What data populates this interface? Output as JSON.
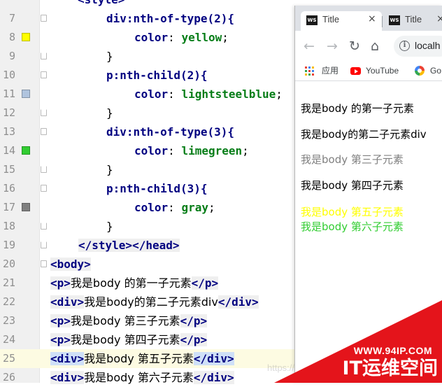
{
  "editor": {
    "lines": [
      {
        "num": "7",
        "swatch": null,
        "fold": "start",
        "indent": 2,
        "parts": [
          [
            "sel",
            "div:nth-of-type(2){"
          ]
        ]
      },
      {
        "num": "8",
        "swatch": "#ffff00",
        "fold": null,
        "indent": 3,
        "parts": [
          [
            "prop",
            "color"
          ],
          [
            "plain",
            ": "
          ],
          [
            "val",
            "yellow"
          ],
          [
            "plain",
            ";"
          ]
        ]
      },
      {
        "num": "9",
        "swatch": null,
        "fold": "end",
        "indent": 2,
        "parts": [
          [
            "plain",
            "}"
          ]
        ]
      },
      {
        "num": "10",
        "swatch": null,
        "fold": "start",
        "indent": 2,
        "parts": [
          [
            "sel",
            "p:nth-child(2){"
          ]
        ]
      },
      {
        "num": "11",
        "swatch": "#b0c4de",
        "fold": null,
        "indent": 3,
        "parts": [
          [
            "prop",
            "color"
          ],
          [
            "plain",
            ": "
          ],
          [
            "val",
            "lightsteelblue"
          ],
          [
            "plain",
            ";"
          ]
        ]
      },
      {
        "num": "12",
        "swatch": null,
        "fold": "end",
        "indent": 2,
        "parts": [
          [
            "plain",
            "}"
          ]
        ]
      },
      {
        "num": "13",
        "swatch": null,
        "fold": "start",
        "indent": 2,
        "parts": [
          [
            "sel",
            "div:nth-of-type(3){"
          ]
        ]
      },
      {
        "num": "14",
        "swatch": "#32cd32",
        "fold": null,
        "indent": 3,
        "parts": [
          [
            "prop",
            "color"
          ],
          [
            "plain",
            ": "
          ],
          [
            "val",
            "limegreen"
          ],
          [
            "plain",
            ";"
          ]
        ]
      },
      {
        "num": "15",
        "swatch": null,
        "fold": "end",
        "indent": 2,
        "parts": [
          [
            "plain",
            "}"
          ]
        ]
      },
      {
        "num": "16",
        "swatch": null,
        "fold": "start",
        "indent": 2,
        "parts": [
          [
            "sel",
            "p:nth-child(3){"
          ]
        ]
      },
      {
        "num": "17",
        "swatch": "#808080",
        "fold": null,
        "indent": 3,
        "parts": [
          [
            "prop",
            "color"
          ],
          [
            "plain",
            ": "
          ],
          [
            "val",
            "gray"
          ],
          [
            "plain",
            ";"
          ]
        ]
      },
      {
        "num": "18",
        "swatch": null,
        "fold": "end",
        "indent": 2,
        "parts": [
          [
            "plain",
            "}"
          ]
        ]
      },
      {
        "num": "19",
        "swatch": null,
        "fold": "end",
        "indent": 1,
        "parts": [
          [
            "tag",
            "</style>"
          ],
          [
            "tag",
            "</head>"
          ]
        ]
      },
      {
        "num": "20",
        "swatch": null,
        "fold": "start",
        "indent": 0,
        "parts": [
          [
            "tag",
            "<body>"
          ]
        ]
      },
      {
        "num": "21",
        "swatch": null,
        "fold": null,
        "indent": 0,
        "parts": [
          [
            "tag",
            "<p>"
          ],
          [
            "cjk",
            "我是body 的第一子元素"
          ],
          [
            "tag",
            "</p>"
          ]
        ]
      },
      {
        "num": "22",
        "swatch": null,
        "fold": null,
        "indent": 0,
        "parts": [
          [
            "tag",
            "<div>"
          ],
          [
            "cjk",
            "我是body的第二子元素div"
          ],
          [
            "tag",
            "</div>"
          ]
        ]
      },
      {
        "num": "23",
        "swatch": null,
        "fold": null,
        "indent": 0,
        "parts": [
          [
            "tag",
            "<p>"
          ],
          [
            "cjk",
            "我是body 第三子元素"
          ],
          [
            "tag",
            "</p>"
          ]
        ]
      },
      {
        "num": "24",
        "swatch": null,
        "fold": null,
        "indent": 0,
        "parts": [
          [
            "tag",
            "<p>"
          ],
          [
            "cjk",
            "我是body 第四子元素"
          ],
          [
            "tag",
            "</p>"
          ]
        ]
      },
      {
        "num": "25",
        "swatch": null,
        "fold": null,
        "indent": 0,
        "current": true,
        "parts": [
          [
            "tagsel",
            "<div>"
          ],
          [
            "cjk",
            "我是body 第五子元素"
          ],
          [
            "tagsel",
            "</div>"
          ]
        ]
      },
      {
        "num": "26",
        "swatch": null,
        "fold": null,
        "indent": 0,
        "parts": [
          [
            "tag",
            "<div>"
          ],
          [
            "cjk",
            "我是body 第六子元素"
          ],
          [
            "tag",
            "</div>"
          ]
        ]
      }
    ],
    "top_partial": "<style>"
  },
  "browser": {
    "tabs": [
      {
        "icon": "WS",
        "title": "Title",
        "close": "×"
      },
      {
        "icon": "WS",
        "title": "Title",
        "close": "×"
      }
    ],
    "url": "localh",
    "bookmarks": [
      {
        "name": "apps",
        "label": "应用"
      },
      {
        "name": "youtube",
        "label": "YouTube"
      },
      {
        "name": "google",
        "label": "Go"
      }
    ],
    "content": [
      {
        "text": "我是body 的第一子元素",
        "color": "#000000"
      },
      {
        "text": "我是body的第二子元素div",
        "color": "#000000"
      },
      {
        "text": "我是body 第三子元素",
        "color": "#808080"
      },
      {
        "text": "我是body 第四子元素",
        "color": "#000000"
      },
      {
        "text": "我是body 第五子元素",
        "color": "#ffff00"
      },
      {
        "text": "我是body 第六子元素",
        "color": "#32cd32"
      }
    ]
  },
  "watermark": {
    "site": "WWW.94IP.COM",
    "brand": "IT运维空间",
    "faint": "https://"
  }
}
